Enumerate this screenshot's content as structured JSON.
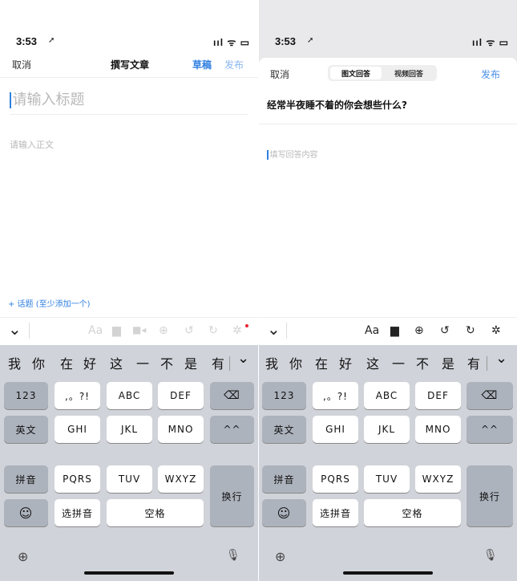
{
  "left": {
    "status": {
      "time": "3:53",
      "indicators": "ııl ᯤ ▭"
    },
    "nav": {
      "cancel": "取消",
      "title": "撰写文章",
      "draft": "草稿",
      "publish": "发布"
    },
    "title_placeholder": "请输入标题",
    "body_placeholder": "请输入正文",
    "topic_link": "+ 话题 (至少添加一个)"
  },
  "right": {
    "status": {
      "time": "3:53",
      "indicators": "ııl ᯤ ▭"
    },
    "nav": {
      "cancel": "取消",
      "tab_text": "图文回答",
      "tab_video": "视频回答",
      "publish": "发布"
    },
    "question": "经常半夜睡不着的你会想些什么?",
    "answer_placeholder": "填写回答内容"
  },
  "toolbar": {
    "collapse": "⌄",
    "font": "Aa",
    "image": "▆",
    "video": "■◂",
    "add": "⊕",
    "undo": "↺",
    "redo": "↻",
    "settings": "✲"
  },
  "keyboard": {
    "candidates": [
      "我",
      "你",
      "在",
      "好",
      "这",
      "一",
      "不",
      "是",
      "有"
    ],
    "expand": "⌄",
    "keys": {
      "k123": "123",
      "punct": ",。?!",
      "abc": "ABC",
      "def": "DEF",
      "backspace": "⌫",
      "english": "英文",
      "ghi": "GHI",
      "jkl": "JKL",
      "mno": "MNO",
      "caret": "^^",
      "pinyin": "拼音",
      "pqrs": "PQRS",
      "tuv": "TUV",
      "wxyz": "WXYZ",
      "enter": "换行",
      "emoji": "☺",
      "select_pinyin": "选拼音",
      "space": "空格"
    },
    "globe": "⊕",
    "mic": "🎙"
  }
}
